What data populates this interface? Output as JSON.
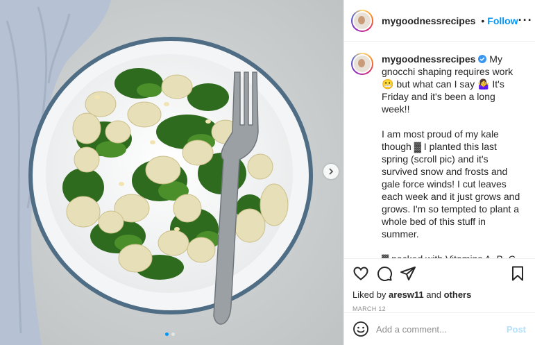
{
  "post": {
    "username": "mygoodnessrecipes",
    "separator": "•",
    "follow_label": "Follow",
    "more_label": "···",
    "caption_user": "mygoodnessrecipes",
    "caption_text": "My gnocchi shaping requires work 😬 but what can I say 🤷‍♀️ It's Friday and it's been a long week!!\n\nI am most proud of my kale though ▓ I planted this last spring (scroll pic) and it's survived snow and frosts and gale force winds! I cut leaves each week and it just grows and grows. I'm so tempted to plant a whole bed of this stuff in summer.\n\n▓ packed with Vitamins A, B, C, and K\n▓ full of antioxidants and phytonutrients\n▓ leafy greens can help reduce dark circles\n▓ kale can promote collagen",
    "liked_by_prefix": "Liked by",
    "liked_by_user": "aresw11",
    "liked_by_and": "and",
    "liked_by_others": "others",
    "date": "MARCH 12",
    "comment_placeholder": "Add a comment...",
    "post_label": "Post"
  },
  "carousel": {
    "total": 2,
    "active_index": 0
  },
  "colors": {
    "accent": "#0095f6",
    "post_disabled": "#b2dffc",
    "muted": "#8e8e8e"
  },
  "icons": {
    "like": "heart-icon",
    "comment": "comment-icon",
    "share": "send-icon",
    "save": "bookmark-icon",
    "emoji": "smiley-icon",
    "verified": "verified-badge-icon",
    "next": "chevron-right-icon"
  }
}
